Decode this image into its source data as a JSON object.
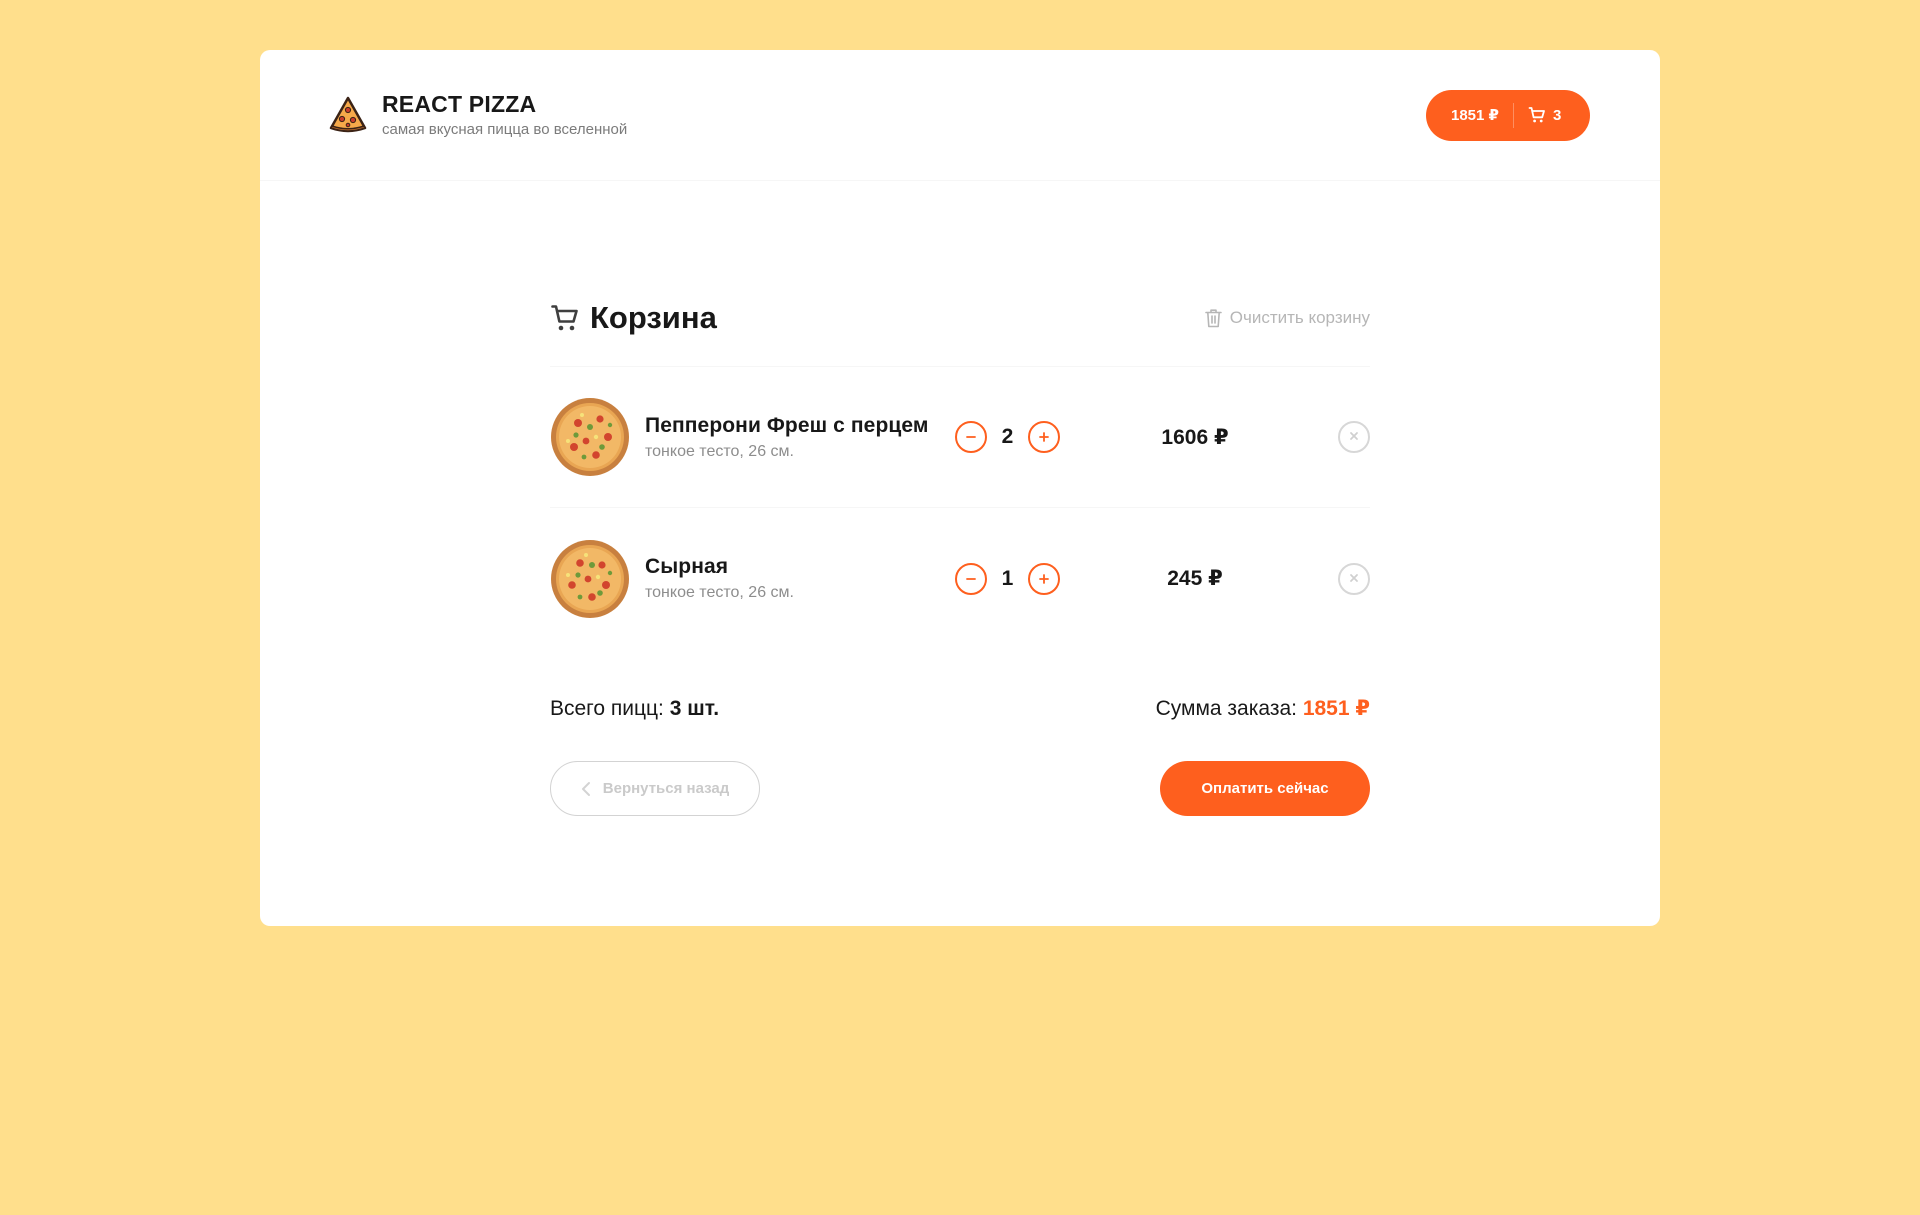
{
  "header": {
    "logo_title": "REACT PIZZA",
    "logo_subtitle": "самая вкусная пицца во вселенной",
    "cart_total": "1851 ₽",
    "cart_count": "3"
  },
  "cart": {
    "title": "Корзина",
    "clear_label": "Очистить корзину",
    "items": [
      {
        "name": "Пепперони Фреш с перцем",
        "desc": "тонкое тесто, 26 см.",
        "count": "2",
        "price": "1606 ₽"
      },
      {
        "name": "Сырная",
        "desc": "тонкое тесто, 26 см.",
        "count": "1",
        "price": "245 ₽"
      }
    ],
    "total_count_label": "Всего пицц:",
    "total_count_value": "3 шт.",
    "total_sum_label": "Сумма заказа:",
    "total_sum_value": "1851 ₽",
    "back_label": "Вернуться назад",
    "pay_label": "Оплатить сейчас"
  },
  "colors": {
    "background": "#FFDF8C",
    "accent": "#FE5F1E",
    "card": "#FFFFFF",
    "muted_text": "#B6B6B6"
  },
  "icons": {
    "logo": "pizza-slice-icon",
    "cart": "cart-icon",
    "trash": "trash-icon",
    "minus": "minus-icon",
    "plus": "plus-icon",
    "remove": "close-icon",
    "back": "chevron-left-icon"
  }
}
